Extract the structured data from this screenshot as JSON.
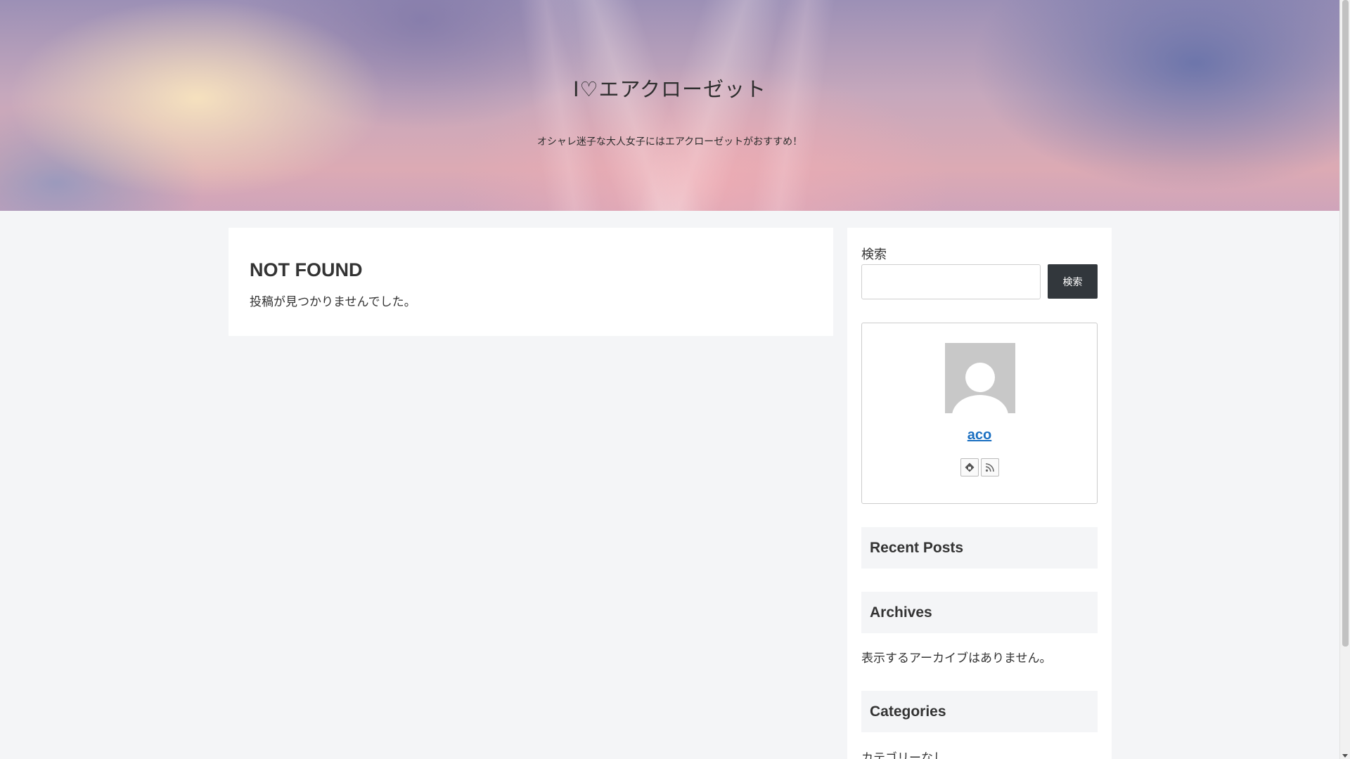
{
  "header": {
    "site_title": "I♡エアクローゼット",
    "tagline": "オシャレ迷子な大人女子にはエアクローゼットがおすすめ！"
  },
  "main": {
    "title": "NOT FOUND",
    "message": "投稿が見つかりませんでした。"
  },
  "sidebar": {
    "search": {
      "label": "検索",
      "placeholder": "",
      "button_label": "検索"
    },
    "author": {
      "name": "aco",
      "icons": [
        "feedly-icon",
        "rss-icon"
      ]
    },
    "recent_posts": {
      "heading": "Recent Posts"
    },
    "archives": {
      "heading": "Archives",
      "text": "表示するアーカイブはありません。"
    },
    "categories": {
      "heading": "Categories",
      "text": "カテゴリーなし"
    }
  }
}
